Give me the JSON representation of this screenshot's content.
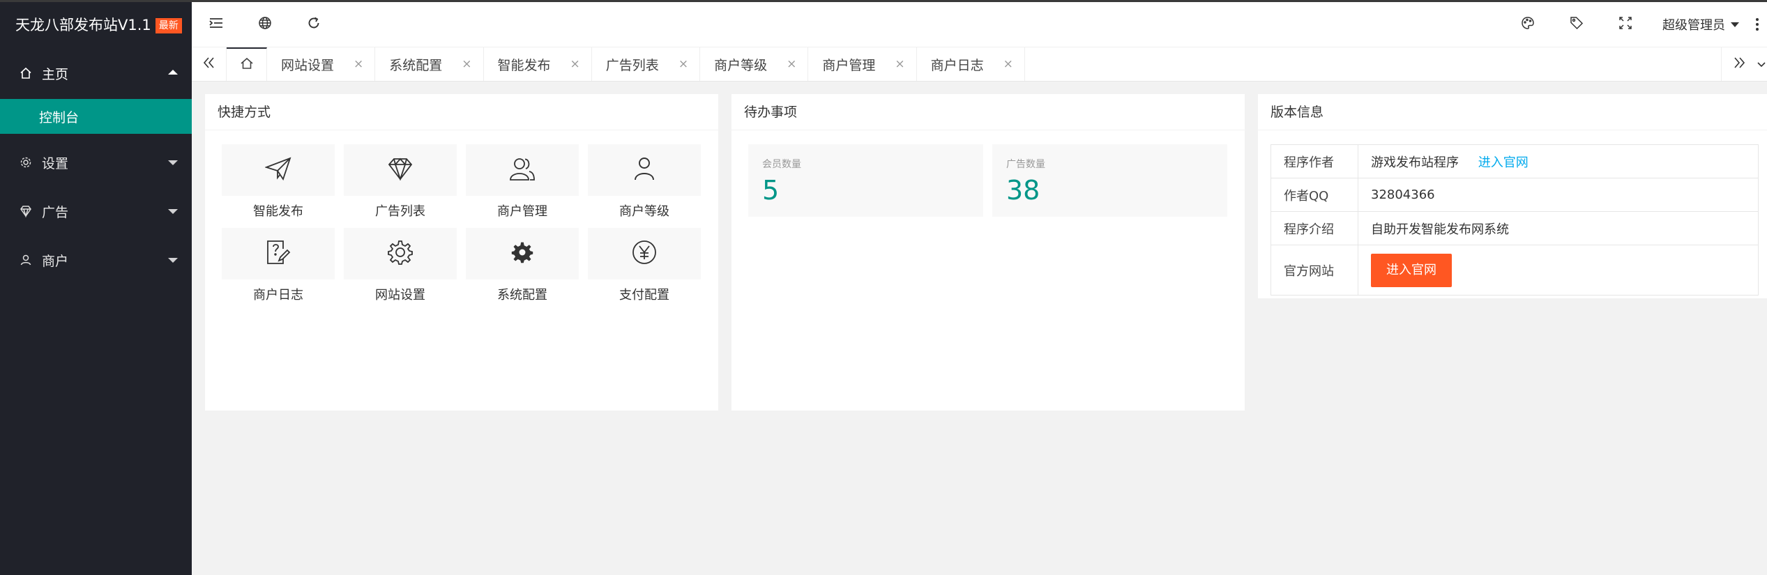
{
  "sidebar": {
    "logo_text": "天龙八部发布站V1.1",
    "logo_badge": "最新",
    "items": [
      {
        "label": "主页",
        "icon": "home-icon",
        "expanded": true
      },
      {
        "label": "设置",
        "icon": "gear-icon"
      },
      {
        "label": "广告",
        "icon": "diamond-icon"
      },
      {
        "label": "商户",
        "icon": "user-icon"
      }
    ],
    "sub_items": [
      {
        "label": "控制台",
        "active": true
      }
    ]
  },
  "header": {
    "left_icons": [
      "menu-fold-icon",
      "globe-icon",
      "refresh-icon"
    ],
    "right_icons": [
      "palette-icon",
      "tag-icon",
      "fullscreen-icon"
    ],
    "user_label": "超级管理员"
  },
  "tabs": [
    {
      "label": "网站设置"
    },
    {
      "label": "系统配置"
    },
    {
      "label": "智能发布"
    },
    {
      "label": "广告列表"
    },
    {
      "label": "商户等级"
    },
    {
      "label": "商户管理"
    },
    {
      "label": "商户日志"
    }
  ],
  "tab_close_glyph": "×",
  "shortcuts": {
    "title": "快捷方式",
    "items": [
      {
        "label": "智能发布",
        "icon": "paper-plane-icon"
      },
      {
        "label": "广告列表",
        "icon": "diamond-icon"
      },
      {
        "label": "商户管理",
        "icon": "users-icon"
      },
      {
        "label": "商户等级",
        "icon": "user-icon"
      },
      {
        "label": "商户日志",
        "icon": "note-question-icon"
      },
      {
        "label": "网站设置",
        "icon": "gear-outline-icon"
      },
      {
        "label": "系统配置",
        "icon": "gear-solid-icon"
      },
      {
        "label": "支付配置",
        "icon": "yen-icon"
      }
    ]
  },
  "todo": {
    "title": "待办事项",
    "items": [
      {
        "label": "会员数量",
        "value": "5"
      },
      {
        "label": "广告数量",
        "value": "38"
      }
    ]
  },
  "version": {
    "title": "版本信息",
    "rows": [
      {
        "key": "程序作者",
        "value": "游戏发布站程序",
        "link": "进入官网"
      },
      {
        "key": "作者QQ",
        "value": "32804366"
      },
      {
        "key": "程序介绍",
        "value": "自助开发智能发布网系统"
      },
      {
        "key": "官方网站",
        "button": "进入官网"
      }
    ]
  },
  "colors": {
    "sidebar_bg": "#20222a",
    "active": "#009688",
    "badge": "#ff5722",
    "link": "#01aaed"
  }
}
